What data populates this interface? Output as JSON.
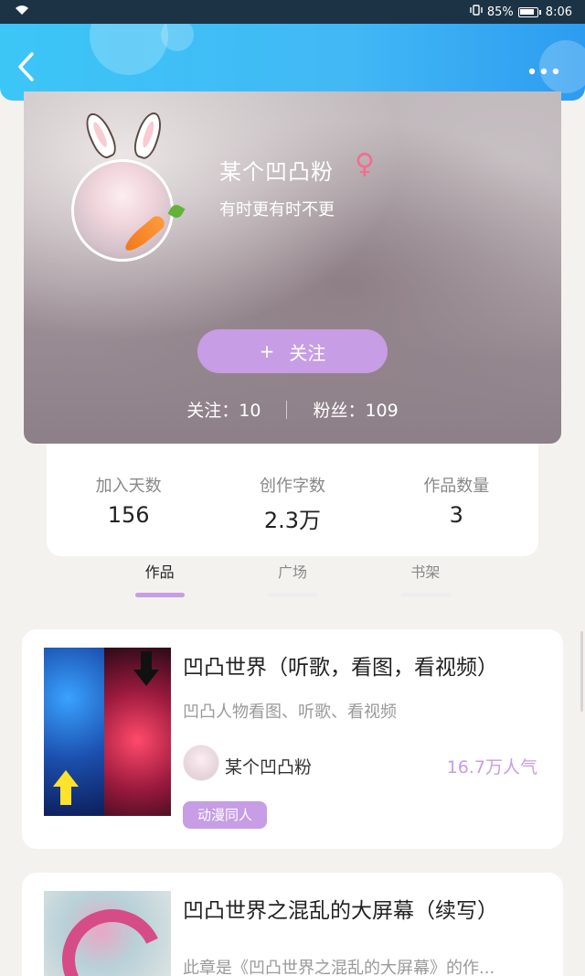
{
  "status_bar": {
    "battery": "85%",
    "time": "8:06"
  },
  "profile": {
    "name": "某个凹凸粉",
    "gender_symbol": "♀",
    "bio": "有时更有时不更",
    "follow_button": {
      "icon": "+",
      "label": "关注"
    },
    "following": "关注：10",
    "fans": "粉丝：109"
  },
  "stats": [
    {
      "label": "加入天数",
      "value": "156"
    },
    {
      "label": "创作字数",
      "value": "2.3万"
    },
    {
      "label": "作品数量",
      "value": "3"
    }
  ],
  "tabs": [
    {
      "label": "作品",
      "active": true
    },
    {
      "label": "广场",
      "active": false
    },
    {
      "label": "书架",
      "active": false
    }
  ],
  "works": [
    {
      "title": "凹凸世界（听歌，看图，看视频）",
      "description": "凹凸人物看图、听歌、看视频",
      "author": "某个凹凸粉",
      "popularity": "16.7万人气",
      "tag": "动漫同人"
    },
    {
      "title": "凹凸世界之混乱的大屏幕（续写）",
      "description": "此章是《凹凸世界之混乱的大屏幕》的作..."
    }
  ],
  "colors": {
    "accent": "#c79de6",
    "header": "#3cc6f6",
    "gender": "#f26d8f"
  }
}
